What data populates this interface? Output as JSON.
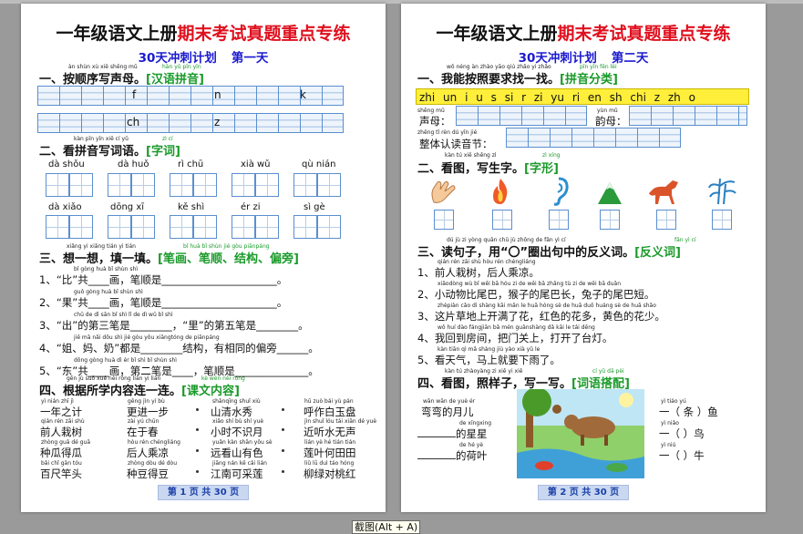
{
  "tooltip": "截图(Alt + A)",
  "page1": {
    "title_black": "一年级语文上册",
    "title_red": "期末考试真题重点专练",
    "subtitle_a": "30天冲刺计划",
    "subtitle_b": "第一天",
    "s1_py": "àn shùn xù xiě shēng mǔ",
    "s1_py2": "hàn yǔ pīn yīn",
    "s1_title": "一、按顺序写声母。",
    "s1_tag": "[汉语拼音]",
    "s1_letters": [
      "f",
      "n",
      "k",
      "ch",
      "z"
    ],
    "s2_py": "kàn pīn yīn xiě cí yǔ",
    "s2_py2": "zì cí",
    "s2_title": "二、看拼音写词语。",
    "s2_tag": "[字词]",
    "s2_words": [
      "dà shǒu",
      "dà huǒ",
      "rì chū",
      "xià wǔ",
      "qù nián",
      "dà xiǎo",
      "dōng xī",
      "kě shì",
      "ér zi",
      "sì gè"
    ],
    "s3_py": "xiǎng yi xiǎng   tián yi tián",
    "s3_py2": "bǐ huà   bǐ shùn  jié gòu   piānpáng",
    "s3_title": "三、想一想，填一填。",
    "s3_tag": "[笔画、笔顺、结构、偏旁]",
    "s3_items": [
      {
        "py": "bǐ    gòng          huà    bǐ shùn shì",
        "text": "1、“比”共____画，笔顺是______________________。"
      },
      {
        "py": "guǒ   gòng          huà    bǐ shùn shì",
        "text": "2、“果”共____画，笔顺是______________________。"
      },
      {
        "py": "chū    de  dì sān bǐ shì           lǐ    de dì wǔ bǐ shì",
        "text": "3、“出”的第三笔是________，“里”的第五笔是________。"
      },
      {
        "py": "jiě    mā    nǎi   dōu shì             jié gòu   yǒu xiāngtóng de piānpáng",
        "text": "4、“姐、妈、奶”都是________结构，有相同的偏旁______。"
      },
      {
        "py": "dōng  gòng         huà    dì  èr  bǐ shì           bǐ shùn shì",
        "text": "5、“东”共____画，第二笔是____，笔顺是______________。"
      }
    ],
    "s4_py": "gēn jù suǒ xué nèi róng lián yi lián",
    "s4_py2": "kè wén nèi róng",
    "s4_title": "四、根据所学内容连一连。",
    "s4_tag": "[课文内容]",
    "s4_rows": [
      [
        {
          "py": "yì nián zhī jì",
          "t": "一年之计"
        },
        {
          "py": "gēng jìn yí bù",
          "t": "更进一步"
        },
        {
          "py": "shānqīng shuǐ xiù",
          "t": "山清水秀"
        },
        {
          "py": "hū zuò bái yù pán",
          "t": "呼作白玉盘"
        }
      ],
      [
        {
          "py": "qián rén zāi shù",
          "t": "前人栽树"
        },
        {
          "py": "zài yú chūn",
          "t": "在于春"
        },
        {
          "py": "xiǎo shí bù shí yuè",
          "t": "小时不识月"
        },
        {
          "py": "jìn shuǐ lóu tái xiān dé yuè",
          "t": "近听水无声"
        }
      ],
      [
        {
          "py": "zhòng guā dé guā",
          "t": "种瓜得瓜"
        },
        {
          "py": "hòu rén chéngliáng",
          "t": "后人乘凉"
        },
        {
          "py": "yuǎn kàn shān yǒu sè",
          "t": "远看山有色"
        },
        {
          "py": "lián yè hé tián tián",
          "t": "莲叶何田田"
        }
      ],
      [
        {
          "py": "bǎi chǐ gān tóu",
          "t": "百尺竿头"
        },
        {
          "py": "zhòng dòu dé dòu",
          "t": "种豆得豆"
        },
        {
          "py": "jiāng nán kě cǎi lián",
          "t": "江南可采莲"
        },
        {
          "py": "liǔ lǜ duì táo hóng",
          "t": "柳绿对桃红"
        }
      ]
    ],
    "footer": "第 1 页 共 30 页"
  },
  "page2": {
    "title_black": "一年级语文上册",
    "title_red": "期末考试真题重点专练",
    "subtitle_a": "30天冲刺计划",
    "subtitle_b": "第二天",
    "s1_py": "wǒ néng àn zhào yāo qiú zhǎo yi zhǎo",
    "s1_py2": "pīn yīn fēn lèi",
    "s1_title": "一、我能按照要求找一找。",
    "s1_tag": "[拼音分类]",
    "yellow_bar": "zhi un i u s si r zi yu ri en sh chi z zh o",
    "shengmu_py": "shēng mǔ",
    "shengmu": "声母：",
    "yunmu_py": "yùn mǔ",
    "yunmu": "韵母：",
    "zhengti_py": "zhěng tǐ rèn dú yīn jié",
    "zhengti": "整体认读音节：",
    "s2_py": "kàn tú    xiě shēng zì",
    "s2_py2": "zì xíng",
    "s2_title": "二、看图，写生字。",
    "s2_tag": "[字形]",
    "s2_icons": [
      "hand-icon",
      "fire-icon",
      "ear-icon",
      "mountain-icon",
      "horse-icon",
      "bamboo-icon"
    ],
    "s2_py_under": "dǎ jù   kāi  yòng      quán chū jù zhòng de fēn yì  cí",
    "s2_py_under2": "fǎn yì cí",
    "s3_py": "dú jù zi     yòng   quān chū jù zhōng de fǎn yì cí",
    "s3_title": "三、读句子，用“〇”圈出句中的反义词。",
    "s3_tag": "[反义词]",
    "s3_items": [
      {
        "py": "qián rén zāi shù      hòu rén chéngliáng",
        "t": "1、前人栽树，后人乘凉。"
      },
      {
        "py": "xiǎodòng wù bǐ wěi bā  hóu zi de wěi bā zhǎng    tù zi de wěi bā duǎn",
        "t": "2、小动物比尾巴，猴子的尾巴长，兔子的尾巴短。"
      },
      {
        "py": "zhèpiàn cǎo dì shàng kāi mǎn le huā   hóng sè de huā duō   huáng sè de huā shǎo",
        "t": "3、这片草地上开满了花，红色的花多，黄色的花少。"
      },
      {
        "py": "wǒ huí dào fángjiān    bǎ mén guānshàng     dǎ kāi le tái dēng",
        "t": "4、我回到房间，把门关上，打开了台灯。"
      },
      {
        "py": "kàn tiān qì     mǎ shàng jiù yào xià yǔ le",
        "t": "5、看天气，马上就要下雨了。"
      }
    ],
    "s4_py": "kàn tú   zhàoyàng zi    xiě yi xiě",
    "s4_py2": "cí yǔ dā pèi",
    "s4_title": "四、看图，照样子，写一写。",
    "s4_tag": "[词语搭配]",
    "s4_left": [
      {
        "py": "wān wān   de yuè ér",
        "t": "弯弯的月儿"
      },
      {
        "py": "de xīngxing",
        "t": "的星星"
      },
      {
        "py": "de hé yè",
        "t": "的荷叶"
      }
    ],
    "s4_right": [
      {
        "py": "yì    tiáo     yú",
        "t": "一（ 条 ）鱼"
      },
      {
        "py": "yì              niǎo",
        "t": "一（    ）鸟"
      },
      {
        "py": "yì              niú",
        "t": "一（    ）牛"
      }
    ],
    "footer": "第 2 页 共 30 页"
  }
}
